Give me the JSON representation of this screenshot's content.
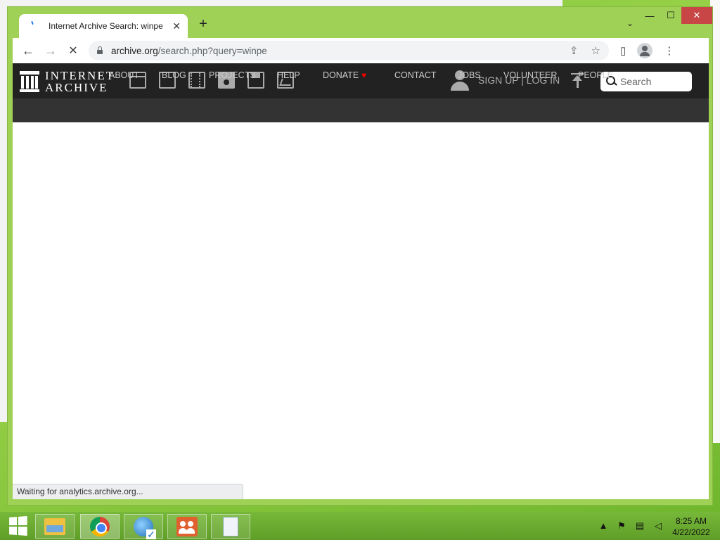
{
  "browser": {
    "tab": {
      "title": "Internet Archive Search: winpe",
      "close_glyph": "✕"
    },
    "new_tab_glyph": "+",
    "tab_search_glyph": "⌄",
    "window_controls": {
      "minimize": "—",
      "maximize": "☐",
      "close": "✕"
    },
    "nav": {
      "back_glyph": "←",
      "forward_glyph": "→",
      "stop_glyph": "✕"
    },
    "address": {
      "host": "archive.org",
      "path": "/search.php?query=winpe"
    },
    "status_text": "Waiting for analytics.archive.org..."
  },
  "site": {
    "logo": {
      "line1": "INTERNET",
      "line2": "ARCHIVE"
    },
    "media_icons": [
      "web-icon",
      "texts-icon",
      "video-icon",
      "audio-icon",
      "software-icon",
      "images-icon"
    ],
    "user_links": "SIGN UP | LOG IN",
    "search_placeholder": "Search",
    "nav_items": [
      "ABOUT",
      "BLOG",
      "PROJECTS",
      "HELP",
      "DONATE",
      "CONTACT",
      "JOBS",
      "VOLUNTEER",
      "PEOPLE"
    ],
    "donate_heart": "♥",
    "colors": {
      "header_bg": "#222222",
      "nav_bg": "#333333",
      "text_muted": "#aaaaaa",
      "heart": "#e00000"
    }
  },
  "taskbar": {
    "apps": [
      "file-explorer-icon",
      "chrome-icon",
      "internet-explorer-icon",
      "user-accounts-icon",
      "document-icon"
    ],
    "clock": {
      "time": "8:25 AM",
      "date": "4/22/2022"
    },
    "tray_up_glyph": "▲"
  }
}
